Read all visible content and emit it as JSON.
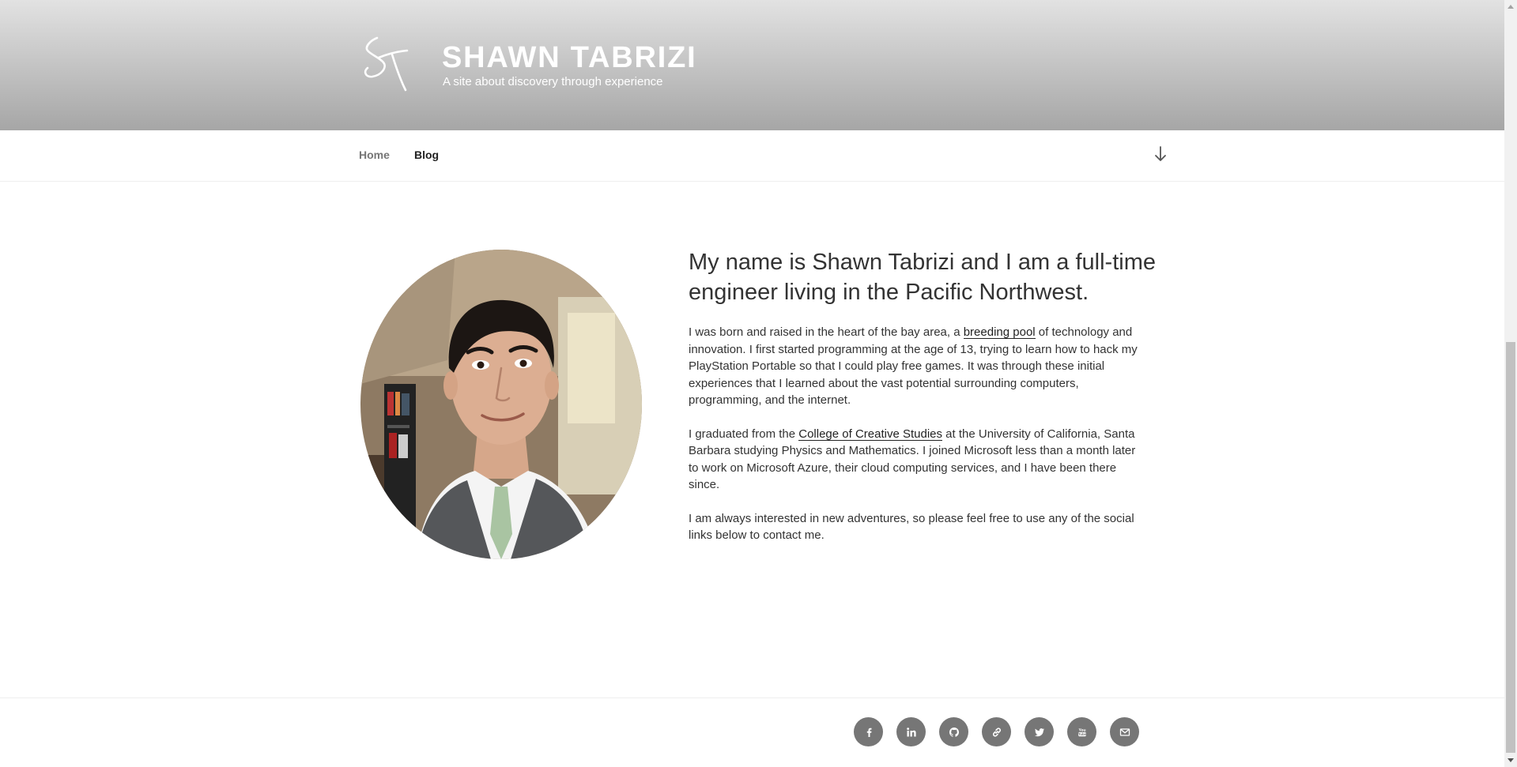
{
  "header": {
    "title": "SHAWN TABRIZI",
    "description": "A site about discovery through experience",
    "logo_icon": "st-signature-logo-icon"
  },
  "nav": {
    "items": [
      {
        "label": "Home"
      },
      {
        "label": "Blog"
      }
    ],
    "scroll_icon": "arrow-down-icon"
  },
  "main": {
    "heading": "My name is Shawn Tabrizi and I am a full-time engineer living in the Pacific Northwest.",
    "p1": {
      "before": "I was born and raised in the heart of the bay area, a ",
      "link": "breeding pool",
      "after": " of technology and innovation. I first started programming at the age of 13, trying to learn how to hack my PlayStation Portable so that I could play free games. It was through these initial experiences that I learned about the vast potential surrounding computers, programming, and the internet."
    },
    "p2": {
      "before": "I graduated from the ",
      "link": "College of Creative Studies",
      "after": " at the University of California, Santa Barbara studying Physics and Mathematics. I joined Microsoft less than a month later to work on Microsoft Azure, their cloud computing services, and I have been there since."
    },
    "p3": "I am always interested in new adventures, so please feel free to use any of the social links below to contact me."
  },
  "footer": {
    "social_icons": [
      "facebook-icon",
      "linkedin-icon",
      "github-icon",
      "link-icon",
      "twitter-icon",
      "youtube-icon",
      "email-icon"
    ]
  },
  "colors": {
    "header_gradient_top": "#e2e2e2",
    "header_gradient_bottom": "#a6a6a6",
    "social_button": "#767676",
    "text": "#333333"
  }
}
